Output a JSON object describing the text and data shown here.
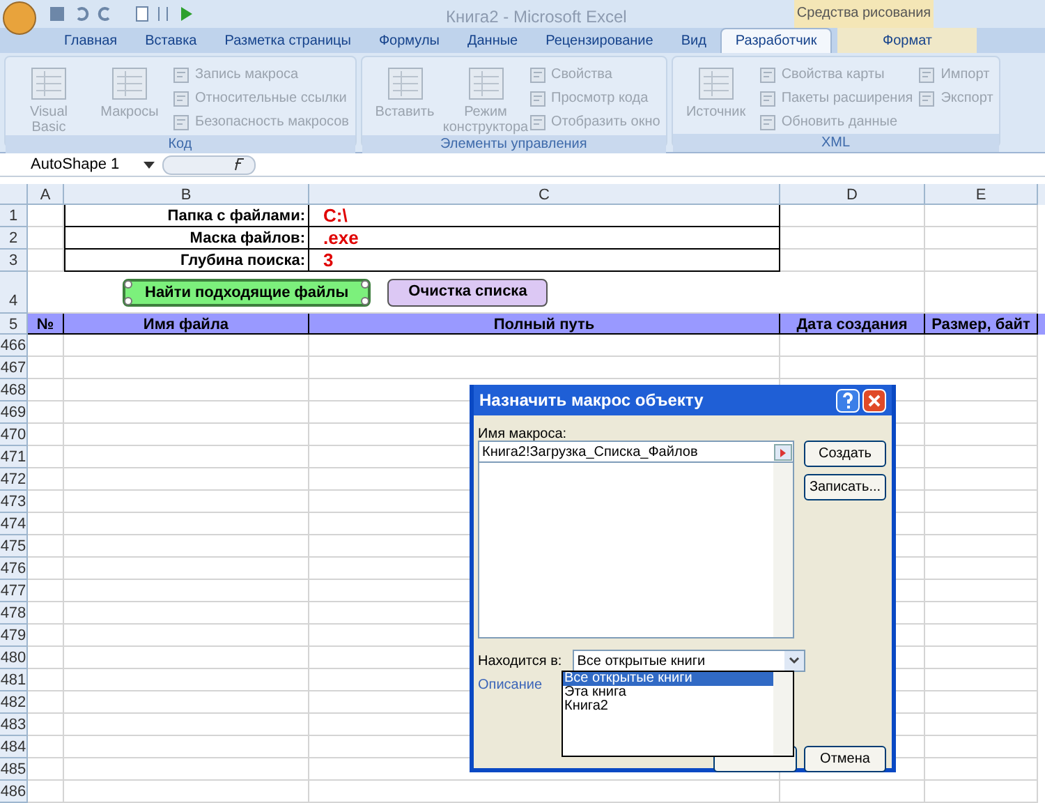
{
  "window": {
    "title": "Книга2 - Microsoft Excel",
    "context_group": "Средства рисования"
  },
  "tabs": [
    {
      "label": "Главная",
      "selected": false,
      "kind": "normal"
    },
    {
      "label": "Вставка",
      "selected": false,
      "kind": "normal"
    },
    {
      "label": "Разметка страницы",
      "selected": false,
      "kind": "normal"
    },
    {
      "label": "Формулы",
      "selected": false,
      "kind": "normal"
    },
    {
      "label": "Данные",
      "selected": false,
      "kind": "normal"
    },
    {
      "label": "Рецензирование",
      "selected": false,
      "kind": "normal"
    },
    {
      "label": "Вид",
      "selected": false,
      "kind": "normal"
    },
    {
      "label": "Разработчик",
      "selected": true,
      "kind": "normal"
    },
    {
      "label": "Формат",
      "selected": false,
      "kind": "context"
    }
  ],
  "ribbon_groups": [
    {
      "title": "Код",
      "items": [
        {
          "kind": "large",
          "label": "Visual Basic",
          "disabled": true
        },
        {
          "kind": "large",
          "label": "Макросы",
          "disabled": true
        },
        {
          "kind": "small",
          "label": "Запись макроса",
          "disabled": true
        },
        {
          "kind": "small",
          "label": "Относительные ссылки",
          "disabled": true
        },
        {
          "kind": "small",
          "label": "Безопасность макросов",
          "disabled": true
        }
      ]
    },
    {
      "title": "Элементы управления",
      "items": [
        {
          "kind": "large",
          "label": "Вставить",
          "disabled": true
        },
        {
          "kind": "large",
          "label": "Режим конструктора",
          "disabled": true
        },
        {
          "kind": "small",
          "label": "Свойства",
          "disabled": true
        },
        {
          "kind": "small",
          "label": "Просмотр кода",
          "disabled": true
        },
        {
          "kind": "small",
          "label": "Отобразить окно",
          "disabled": true
        }
      ]
    },
    {
      "title": "XML",
      "items": [
        {
          "kind": "large",
          "label": "Источник",
          "disabled": true
        },
        {
          "kind": "small",
          "label": "Свойства карты",
          "disabled": true
        },
        {
          "kind": "small",
          "label": "Пакеты расширения",
          "disabled": true
        },
        {
          "kind": "small",
          "label": "Обновить данные",
          "disabled": true
        },
        {
          "kind": "small",
          "label": "Импорт",
          "disabled": true
        },
        {
          "kind": "small",
          "label": "Экспорт",
          "disabled": true
        }
      ]
    }
  ],
  "formula_bar": {
    "name_box": "AutoShape 1"
  },
  "sheet": {
    "columns": [
      "A",
      "B",
      "C",
      "D",
      "E"
    ],
    "params": [
      {
        "row": "1",
        "label": "Папка с файлами:",
        "value": "C:\\"
      },
      {
        "row": "2",
        "label": "Маска файлов:",
        "value": ".exe"
      },
      {
        "row": "3",
        "label": "Глубина поиска:",
        "value": "3"
      }
    ],
    "shapes_row": "4",
    "shapes": [
      {
        "label": "Найти подходящие файлы",
        "selected": true,
        "color": "#7cf07c"
      },
      {
        "label": "Очистка списка",
        "selected": false,
        "color": "#dcc8f4"
      }
    ],
    "header_row": "5",
    "headers": [
      "№",
      "Имя файла",
      "Полный путь",
      "Дата создания",
      "Размер, байт"
    ],
    "rows": [
      "466",
      "467",
      "468",
      "469",
      "470",
      "471",
      "472",
      "473",
      "474",
      "475",
      "476",
      "477",
      "478",
      "479",
      "480",
      "481",
      "482",
      "483",
      "484",
      "485",
      "486"
    ]
  },
  "dialog": {
    "title": "Назначить макрос объекту",
    "macro_name_label": "Имя макроса:",
    "macro_name": "Книга2!Загрузка_Списка_Файлов",
    "buttons": [
      "Создать",
      "Записать..."
    ],
    "location_label": "Находится в:",
    "location_value": "Все открытые книги",
    "location_options": [
      {
        "label": "Все открытые книги",
        "selected": true
      },
      {
        "label": "Эта книга",
        "selected": false
      },
      {
        "label": "Книга2",
        "selected": false
      }
    ],
    "description_label": "Описание",
    "cancel": "Отмена"
  }
}
